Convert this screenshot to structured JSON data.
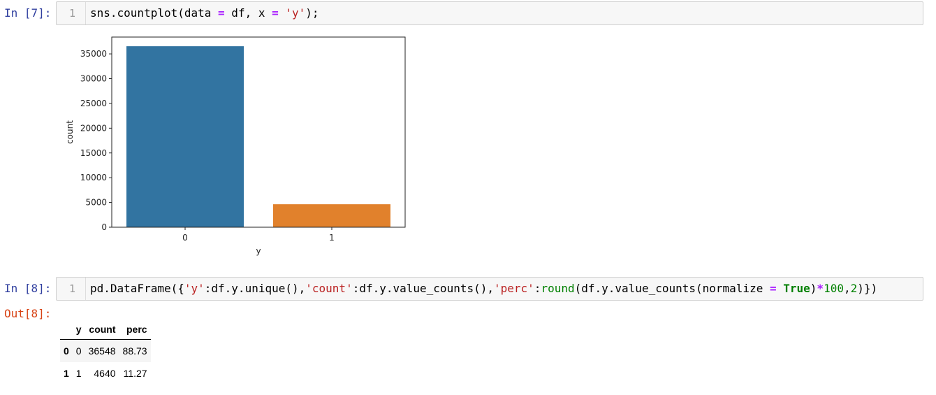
{
  "cells": [
    {
      "prompt": "In [7]:",
      "line_number": "1",
      "code_tokens": [
        {
          "text": "sns.countplot(data ",
          "cls": ""
        },
        {
          "text": "=",
          "cls": "t-op"
        },
        {
          "text": " df, x ",
          "cls": ""
        },
        {
          "text": "=",
          "cls": "t-op"
        },
        {
          "text": " ",
          "cls": ""
        },
        {
          "text": "'y'",
          "cls": "t-str"
        },
        {
          "text": ");",
          "cls": ""
        }
      ]
    },
    {
      "prompt": "In [8]:",
      "line_number": "1",
      "output_prompt": "Out[8]:",
      "code_tokens": [
        {
          "text": "pd.DataFrame({",
          "cls": ""
        },
        {
          "text": "'y'",
          "cls": "t-str"
        },
        {
          "text": ":df.y.unique(),",
          "cls": ""
        },
        {
          "text": "'count'",
          "cls": "t-str"
        },
        {
          "text": ":df.y.value_counts(),",
          "cls": ""
        },
        {
          "text": "'perc'",
          "cls": "t-str"
        },
        {
          "text": ":",
          "cls": ""
        },
        {
          "text": "round",
          "cls": "t-bi"
        },
        {
          "text": "(df.y.value_counts(normalize ",
          "cls": ""
        },
        {
          "text": "=",
          "cls": "t-op"
        },
        {
          "text": " ",
          "cls": ""
        },
        {
          "text": "True",
          "cls": "t-kw"
        },
        {
          "text": ")",
          "cls": ""
        },
        {
          "text": "*",
          "cls": "t-op"
        },
        {
          "text": "100",
          "cls": "t-num"
        },
        {
          "text": ",",
          "cls": ""
        },
        {
          "text": "2",
          "cls": "t-num"
        },
        {
          "text": ")})",
          "cls": ""
        }
      ]
    }
  ],
  "chart_data": {
    "type": "bar",
    "categories": [
      "0",
      "1"
    ],
    "values": [
      36548,
      4640
    ],
    "colors": [
      "#3274a1",
      "#e1812c"
    ],
    "xlabel": "y",
    "ylabel": "count",
    "ylim": [
      0,
      38400
    ],
    "yticks": [
      0,
      5000,
      10000,
      15000,
      20000,
      25000,
      30000,
      35000
    ],
    "grid": false
  },
  "table": {
    "columns": [
      "",
      "y",
      "count",
      "perc"
    ],
    "rows": [
      {
        "index": "0",
        "y": "0",
        "count": "36548",
        "perc": "88.73"
      },
      {
        "index": "1",
        "y": "1",
        "count": "4640",
        "perc": "11.27"
      }
    ]
  }
}
